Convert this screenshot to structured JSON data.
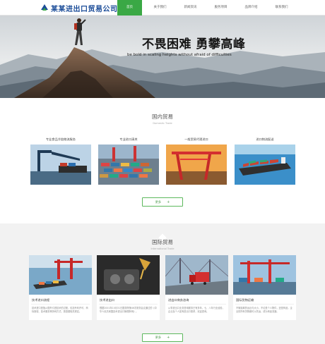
{
  "header": {
    "logo_text": "某某进出口贸易公司",
    "nav": [
      "首页",
      "关于我们",
      "新闻资讯",
      "服务项目",
      "品牌介绍",
      "联系我们"
    ],
    "active_index": 0
  },
  "banner": {
    "title": "不畏困难 勇攀高峰",
    "subtitle": "be bold in scaling heights without afraid of difficulties"
  },
  "domestic": {
    "title": "国内贸易",
    "subtitle": "Domestic Trade",
    "cards": [
      {
        "label": "专业食品冷链物流服务"
      },
      {
        "label": "专业进口清关"
      },
      {
        "label": "一般贸易代理进口"
      },
      {
        "label": "进口物流配送"
      }
    ],
    "more_label": "更多",
    "more_icon": "plus-icon"
  },
  "international": {
    "title": "国际贸易",
    "subtitle": "International Trade",
    "cards": [
      {
        "title": "技术进口流程",
        "text": "技术进口是指从国外引进技术的过程，包括专利许可、商标授权、技术服务等多种方式，需遵循相关规定。"
      },
      {
        "title": "技术进出口",
        "text": "根据2001年10月31日国务院第46次常务会议通过的《中华人民共和国技术进出口管理条例》。"
      },
      {
        "title": "进出口商务咨询",
        "text": "从事进出口业务咨询服务已有多年，七、八年行业经验，企业及个人如有进出口需求，欢迎咨询。"
      },
      {
        "title": "国际货物运输",
        "text": "不管距离的远近与大小，不论是个人物件，还是商品，企业的所有货物都可以托运，成为商品流通。"
      }
    ],
    "more_label": "更多",
    "more_icon": "plus-icon"
  },
  "colors": {
    "accent": "#3aa845",
    "logo": "#1c4d99"
  }
}
